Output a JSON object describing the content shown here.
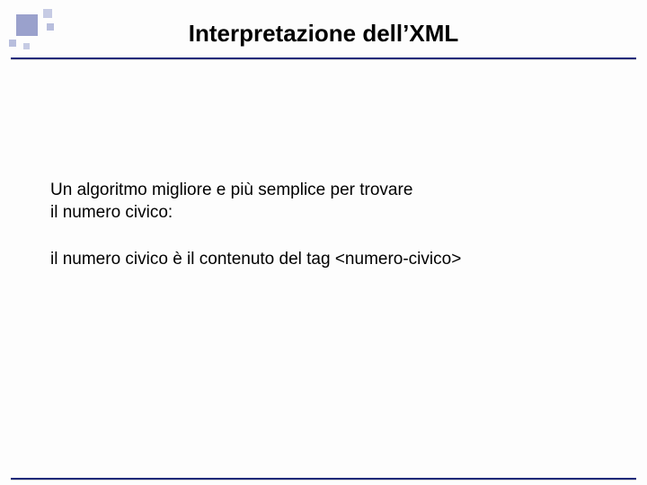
{
  "slide": {
    "title": "Interpretazione dell’XML",
    "para1_line1": "Un algoritmo migliore e più semplice per trovare",
    "para1_line2": "il numero civico:",
    "para2": "il numero civico è il contenuto del tag <numero-civico>"
  }
}
